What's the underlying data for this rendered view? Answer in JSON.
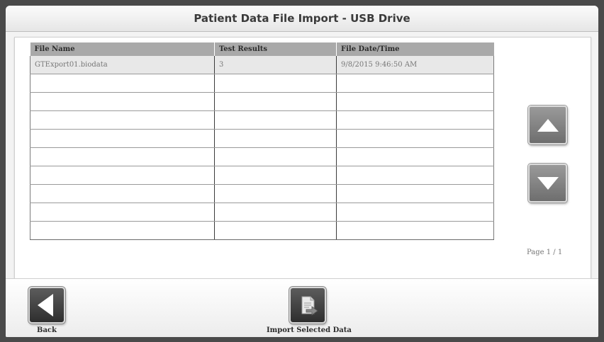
{
  "title": "Patient Data File Import - USB Drive",
  "table": {
    "columns": [
      "File Name",
      "Test Results",
      "File Date/Time"
    ],
    "rows": [
      [
        "GTExport01.biodata",
        "3",
        "9/8/2015 9:46:50 AM"
      ],
      [
        "",
        "",
        ""
      ],
      [
        "",
        "",
        ""
      ],
      [
        "",
        "",
        ""
      ],
      [
        "",
        "",
        ""
      ],
      [
        "",
        "",
        ""
      ],
      [
        "",
        "",
        ""
      ],
      [
        "",
        "",
        ""
      ],
      [
        "",
        "",
        ""
      ],
      [
        "",
        "",
        ""
      ]
    ],
    "selected_row": 0
  },
  "scroll": {
    "up_icon": "triangle-up-icon",
    "down_icon": "triangle-down-icon"
  },
  "pagination": {
    "label": "Page 1 / 1"
  },
  "footer": {
    "back_label": "Back",
    "back_icon": "triangle-left-icon",
    "import_label": "Import Selected Data",
    "import_icon": "import-document-icon"
  }
}
